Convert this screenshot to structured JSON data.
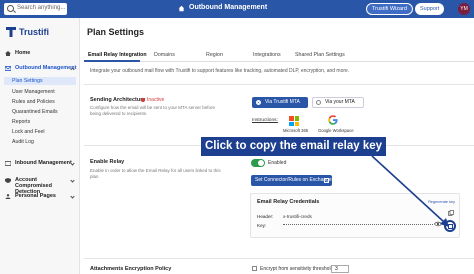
{
  "topbar": {
    "search_placeholder": "Search anything...",
    "title": "Outbound Management",
    "wizard_label": "Trustifi Wizard",
    "support_label": "Support",
    "avatar_initials": "YM",
    "bar_color": "#2a56a8"
  },
  "sidebar": {
    "logo_text": "Trustifi",
    "items": [
      {
        "label": "Home",
        "icon": "home-icon"
      },
      {
        "label": "Outbound Management",
        "icon": "outbound-icon",
        "expanded": true,
        "subitems": [
          "Plan Settings",
          "User Management",
          "Rules and Policies",
          "Quarantined Emails",
          "Reports",
          "Lock and Feel",
          "Audit Log"
        ]
      },
      {
        "label": "Inbound Management",
        "icon": "inbound-icon"
      },
      {
        "label": "Account Compromised Detection",
        "icon": "shield-icon"
      },
      {
        "label": "Personal Pages",
        "icon": "person-icon"
      }
    ],
    "active_subitem": "Plan Settings"
  },
  "main": {
    "title": "Plan Settings",
    "tabs": [
      "Email Relay Integration",
      "Domains",
      "Region",
      "Integrations",
      "Shared Plan Settings"
    ],
    "active_tab": "Email Relay Integration",
    "intro": "Integrate your outbound mail flow with Trustifi to support features like tracking, automated DLP, encryption, and more.",
    "sending_architecture": {
      "label": "Sending Architecture",
      "status": "Inactive",
      "description": "Configure how the email will be sent to your MTA server before being delivered to recipients.",
      "options": [
        "Via Trustifi MTA",
        "Via your MTA"
      ],
      "selected": "Via Trustifi MTA",
      "instructions_label": "Instructions:",
      "providers": [
        "Microsoft 365",
        "Google Workspace"
      ]
    },
    "enable_relay": {
      "label": "Enable Relay",
      "description": "Enable in order to allow the Email Relay for all users linked to this plan",
      "toggle_text": "Enabled",
      "toggle_on": true,
      "connector_button": "Set Connector/Rules on Exchange"
    },
    "credentials": {
      "title": "Email Relay Credentials",
      "regenerate_link": "Regenerate key",
      "header_label": "Header:",
      "header_value": "x-trustifi-creds",
      "key_label": "Key:"
    },
    "attachments": {
      "label": "Attachments Encryption Policy",
      "option": "Encrypt from sensitivity threshold",
      "threshold": "3"
    }
  },
  "callout": {
    "text": "Click to copy the email relay key",
    "color": "#1c3f8f"
  }
}
